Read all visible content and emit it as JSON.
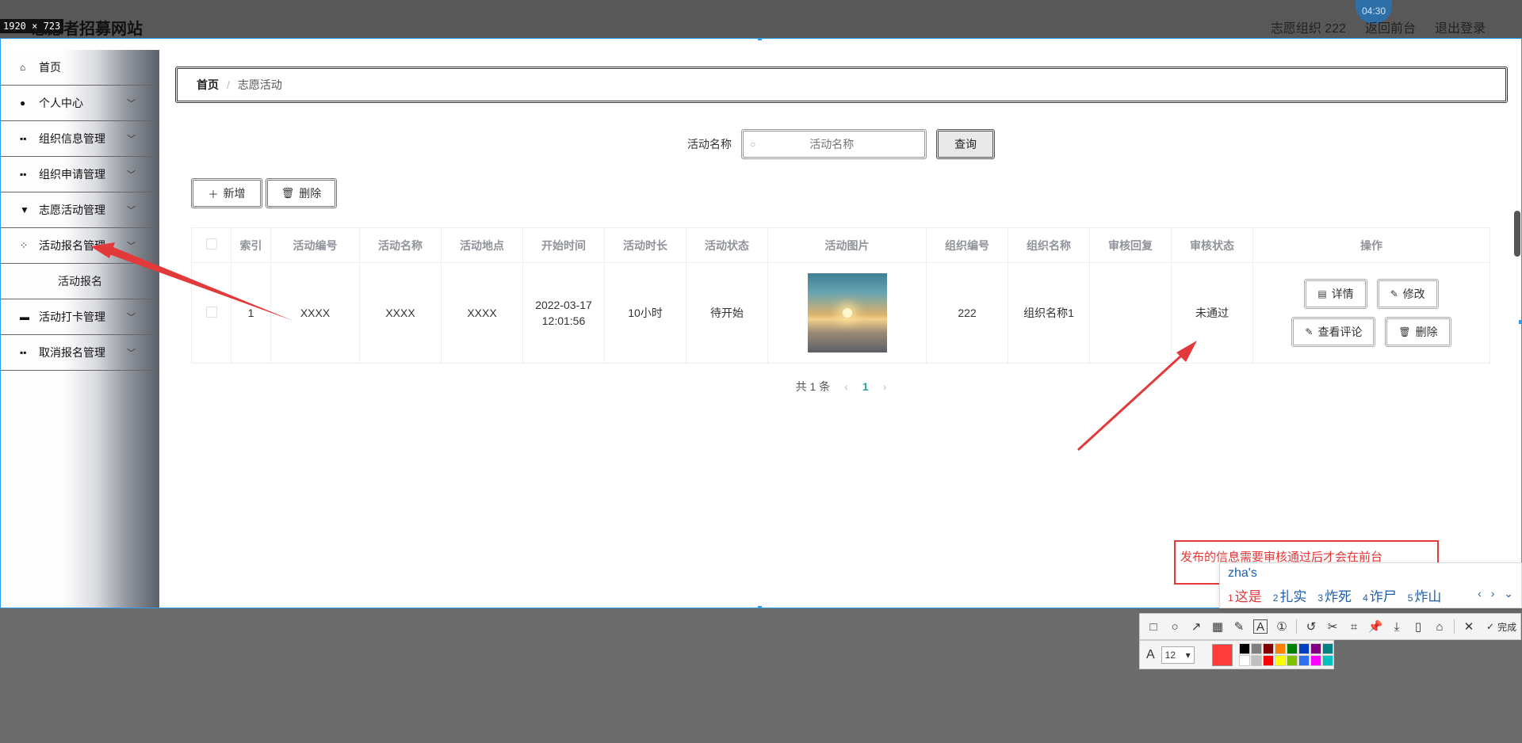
{
  "header": {
    "site_title": "志愿者招募网站",
    "dim_label": "1920 × 723",
    "timer": "04:30",
    "user_label": "志愿组织 222",
    "frontend_link": "返回前台",
    "logout_link": "退出登录"
  },
  "sidebar": {
    "items": [
      {
        "label": "首页",
        "icon": "home-icon"
      },
      {
        "label": "个人中心",
        "icon": "user-icon"
      },
      {
        "label": "组织信息管理",
        "icon": "grid-icon"
      },
      {
        "label": "组织申请管理",
        "icon": "grid-icon"
      },
      {
        "label": "志愿活动管理",
        "icon": "brush-icon"
      },
      {
        "label": "活动报名管理",
        "icon": "apps-icon"
      },
      {
        "label": "活动报名",
        "icon": ""
      },
      {
        "label": "活动打卡管理",
        "icon": "briefcase-icon"
      },
      {
        "label": "取消报名管理",
        "icon": "grid-icon"
      }
    ]
  },
  "breadcrumb": {
    "home": "首页",
    "separator": "/",
    "current": "志愿活动"
  },
  "search": {
    "label": "活动名称",
    "placeholder": "活动名称",
    "button": "查询"
  },
  "toolbar": {
    "add": "新增",
    "delete": "删除"
  },
  "table": {
    "headers": [
      "索引",
      "活动编号",
      "活动名称",
      "活动地点",
      "开始时间",
      "活动时长",
      "活动状态",
      "活动图片",
      "组织编号",
      "组织名称",
      "审核回复",
      "审核状态",
      "操作"
    ],
    "rows": [
      {
        "index": "1",
        "code": "XXXX",
        "name": "XXXX",
        "place": "XXXX",
        "start_date": "2022-03-17",
        "start_time": "12:01:56",
        "duration": "10小时",
        "status": "待开始",
        "org_code": "222",
        "org_name": "组织名称1",
        "review_reply": "",
        "review_status": "未通过",
        "actions": {
          "detail": "详情",
          "edit": "修改",
          "comments": "查看评论",
          "delete": "删除"
        }
      }
    ]
  },
  "pager": {
    "total": "共 1 条",
    "page": "1"
  },
  "annotation": {
    "text": "发布的信息需要审核通过后才会在前台",
    "color": "#e23a3a"
  },
  "ime": {
    "input": "zha's",
    "candidates": [
      {
        "n": "1",
        "text": "这是"
      },
      {
        "n": "2",
        "text": "扎实"
      },
      {
        "n": "3",
        "text": "炸死"
      },
      {
        "n": "4",
        "text": "诈尸"
      },
      {
        "n": "5",
        "text": "炸山"
      }
    ]
  },
  "shot_toolbar": {
    "done": "完成",
    "font_size": "12",
    "current_color": "#ff3b3b",
    "palette": [
      "#000000",
      "#808080",
      "#800000",
      "#ff8000",
      "#008000",
      "#0040c0",
      "#800080",
      "#008080",
      "#ffffff",
      "#c0c0c0",
      "#ff0000",
      "#ffff00",
      "#80c000",
      "#3070f0",
      "#ff00ff",
      "#00c0c0"
    ]
  },
  "colors": {
    "accent": "#2aa1a1",
    "capture_border": "#2d9bf0",
    "arrow": "#e23a3a"
  }
}
